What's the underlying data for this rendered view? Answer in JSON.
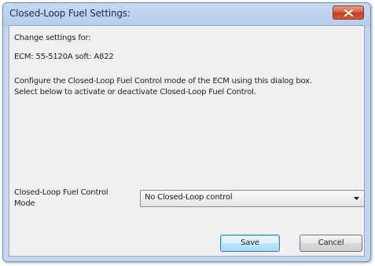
{
  "window": {
    "title": "Closed-Loop Fuel Settings:"
  },
  "content": {
    "change_settings_label": "Change settings for:",
    "ecm_info": "ECM: 55-5120A soft: A822",
    "description_line1": "Configure the Closed-Loop Fuel Control mode of the ECM using this dialog box.",
    "description_line2": "Select below to activate or deactivate Closed-Loop Fuel Control."
  },
  "mode": {
    "label_line1": "Closed-Loop Fuel Control",
    "label_line2": "Mode",
    "selected_value": "No Closed-Loop control"
  },
  "buttons": {
    "save": "Save",
    "cancel": "Cancel"
  },
  "icons": {
    "close": "close-icon",
    "dropdown": "chevron-down-icon"
  },
  "colors": {
    "titlebar": "#b4cdec",
    "close_button": "#c4391d",
    "dialog_background": "#f0f0f0",
    "default_button_border": "#3c7fb1"
  }
}
